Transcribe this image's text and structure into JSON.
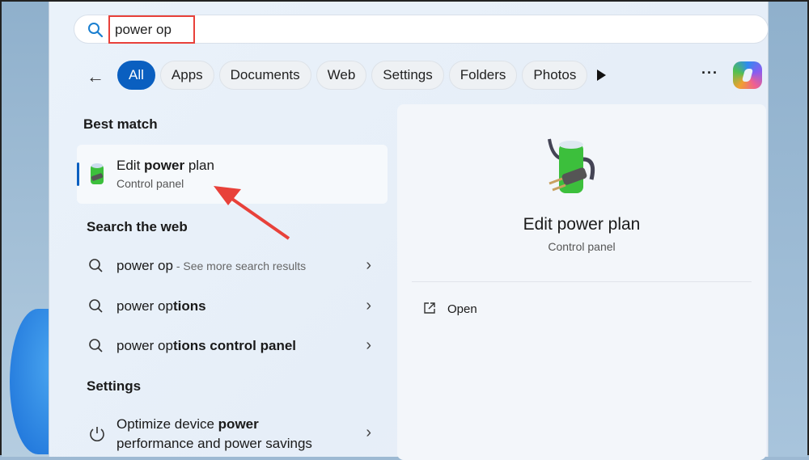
{
  "search": {
    "query": "power op"
  },
  "filters": [
    "All",
    "Apps",
    "Documents",
    "Web",
    "Settings",
    "Folders",
    "Photos"
  ],
  "sections": {
    "best_match": "Best match",
    "search_web": "Search the web",
    "settings": "Settings"
  },
  "best_match": {
    "title_pre": "Edit ",
    "title_bold": "power",
    "title_post": " plan",
    "subtitle": "Control panel"
  },
  "web": [
    {
      "plain": "power op",
      "bold": "",
      "suffix": " - See more search results"
    },
    {
      "plain": "power op",
      "bold": "tions",
      "suffix": ""
    },
    {
      "plain": "power op",
      "bold": "tions control panel",
      "suffix": ""
    }
  ],
  "setting": {
    "line1_pre": "Optimize device ",
    "line1_bold": "power",
    "line2": "performance and power savings"
  },
  "detail": {
    "title": "Edit power plan",
    "subtitle": "Control panel",
    "action": "Open"
  },
  "colors": {
    "accent": "#0a5fc0",
    "highlight": "#e8413a"
  }
}
